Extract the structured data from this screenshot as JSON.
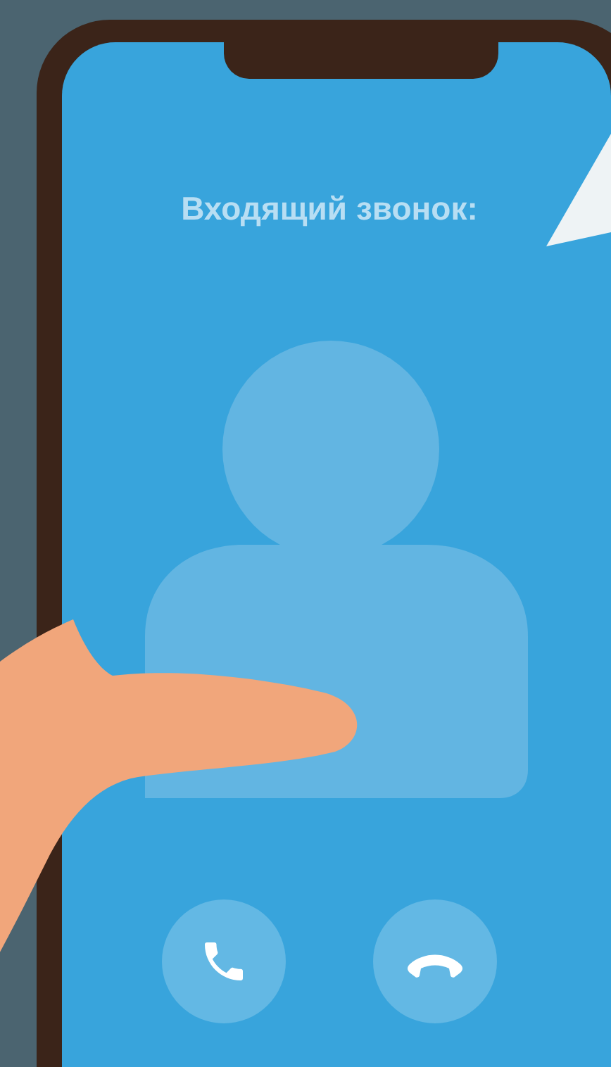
{
  "screen": {
    "title": "Входящий звонок:"
  },
  "actions": [
    {
      "kind": "accept"
    },
    {
      "kind": "decline"
    }
  ]
}
